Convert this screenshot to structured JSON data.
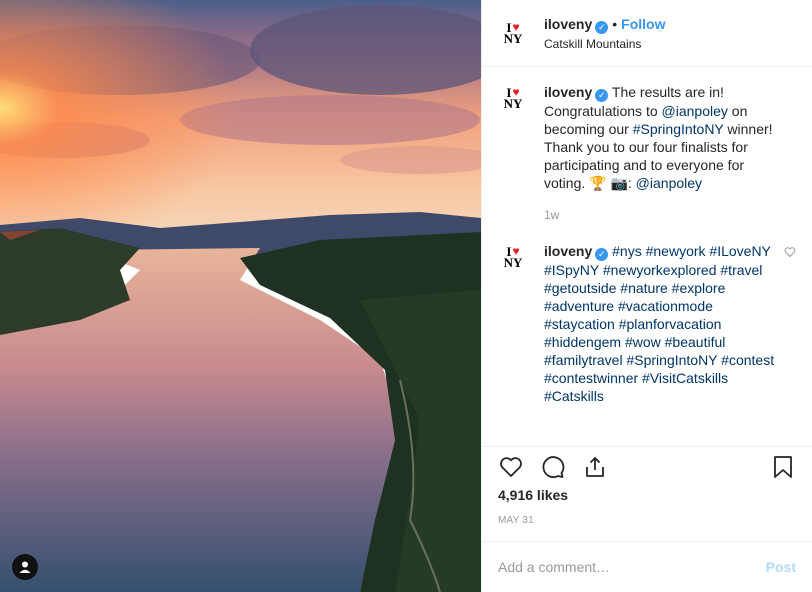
{
  "header": {
    "username": "iloveny",
    "follow_label": "Follow",
    "location": "Catskill Mountains",
    "logo_top": "I",
    "logo_bottom": "NY"
  },
  "comments": [
    {
      "username": "iloveny",
      "text_pre": "The results are in! Congratulations to ",
      "mention": "@ianpoley",
      "text_mid": " on becoming our ",
      "hashtag": "#SpringIntoNY",
      "text_post": " winner! Thank you to our four finalists for participating and to everyone for voting. 🏆 📷: ",
      "mention2": "@ianpoley",
      "time": "1w"
    },
    {
      "username": "iloveny",
      "hashtags": "#nys #newyork #ILoveNY #ISpyNY #newyorkexplored #travel #getoutside #nature #explore #adventure #vacationmode #staycation #planforvacation #hiddengem #wow #beautiful #familytravel #SpringIntoNY #contest #contestwinner #VisitCatskills #Catskills"
    }
  ],
  "likes": "4,916 likes",
  "date": "MAY 31",
  "add_comment_placeholder": "Add a comment…",
  "post_label": "Post",
  "icons": [
    "heart-icon",
    "comment-icon",
    "share-icon",
    "bookmark-icon",
    "user-tag-icon",
    "verified-badge-icon"
  ],
  "colors": {
    "link": "#3897f0",
    "hashtag": "#003569",
    "heart": "#e21d24",
    "post_disabled": "#b3dbff"
  }
}
